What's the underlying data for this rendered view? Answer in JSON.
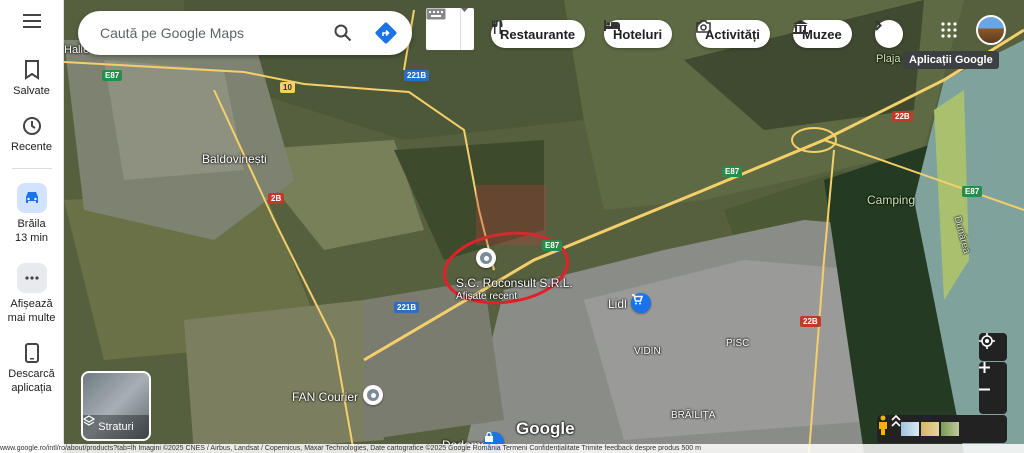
{
  "sidebar": {
    "menu_icon": "hamburger-menu-icon",
    "items": [
      {
        "label": "Salvate",
        "icon": "bookmark-icon"
      },
      {
        "label": "Recente",
        "icon": "history-icon"
      },
      {
        "label": "Brăila",
        "sublabel": "13 min",
        "icon": "car-icon"
      },
      {
        "label": "Afișează",
        "sublabel": "mai multe",
        "icon": "more-icon"
      },
      {
        "label": "Descarcă",
        "sublabel": "aplicația",
        "icon": "phone-icon"
      }
    ]
  },
  "search": {
    "placeholder": "Caută pe Google Maps",
    "search_icon": "search-icon",
    "directions_icon": "directions-icon"
  },
  "keyboard_icon": "keyboard-icon",
  "chips": [
    {
      "label": "Restaurante",
      "icon": "fork-knife-icon"
    },
    {
      "label": "Hoteluri",
      "icon": "bed-icon"
    },
    {
      "label": "Activități",
      "icon": "camera-icon"
    },
    {
      "label": "Muzee",
      "icon": "museum-icon"
    }
  ],
  "apps_tooltip": "Aplicații Google",
  "map_labels": {
    "baldovinesti": "Baldovinești",
    "camping": "Camping",
    "plaja": "Plaja",
    "place_name": "S.C. Roconsult S.R.L.",
    "place_sub": "Afișate recent",
    "lidl": "Lidl",
    "vidin": "VIDIN",
    "pisc": "PISC",
    "brailita": "BRĂILIȚA",
    "fan_courier": "FAN Courier",
    "dedeman": "Dedeman",
    "dunarea": "Dunărea",
    "halle": "Halle",
    "google": "Google"
  },
  "road_shields": {
    "e87": "E87",
    "r10": "10",
    "r221b": "221B",
    "r22b": "22B",
    "r2b": "2B"
  },
  "layers_label": "Straturi",
  "footer_text": "www.google.ro/intl/ro/about/products?tab=lh   Imagini ©2025 CNES / Airbus, Landsat / Copernicus, Maxar Technologies, Date cartografice ©2025 Google   România   Termeni   Confidențialitate   Trimite feedback despre produs   500 m",
  "colors": {
    "accent": "#1a73e8",
    "directions": "#00897b",
    "road": "#f4cf6a",
    "circle": "#e3202a"
  }
}
